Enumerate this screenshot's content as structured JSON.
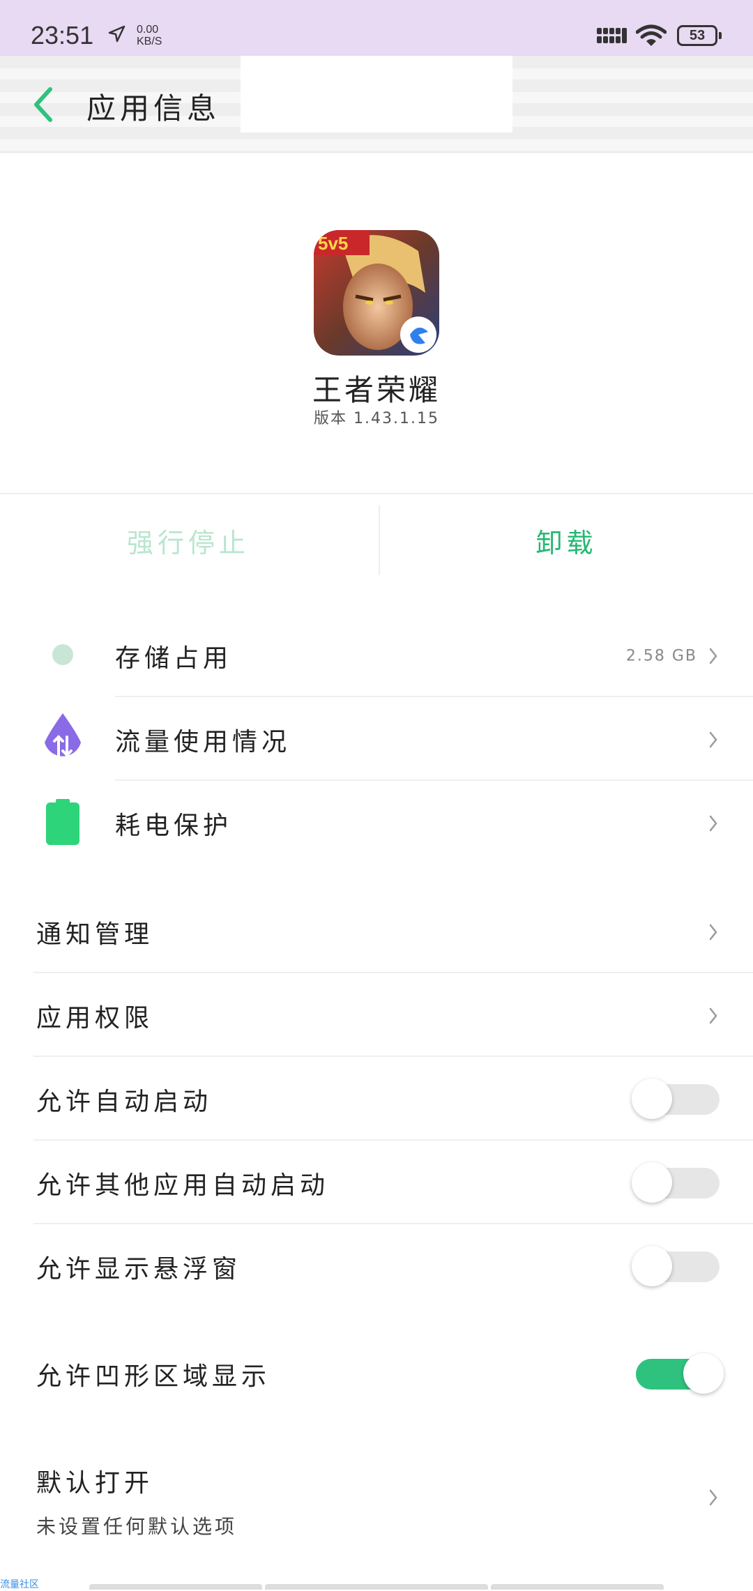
{
  "status_bar": {
    "time": "23:51",
    "speed_value": "0.00",
    "speed_unit": "KB/S",
    "battery": "53",
    "background": "#e8daf2"
  },
  "header": {
    "title": "应用信息",
    "back_icon": "chevron-left-icon"
  },
  "app": {
    "name": "王者荣耀",
    "version": "版本 1.43.1.15"
  },
  "actions": {
    "force_stop": "强行停止",
    "uninstall": "卸载",
    "accent": "#25b873",
    "disabled_color": "#b8e6cf"
  },
  "rows_group1": [
    {
      "label": "存储占用",
      "value": "2.58 GB",
      "icon": "storage-dot-icon"
    },
    {
      "label": "流量使用情况",
      "icon": "data-usage-drop-icon"
    },
    {
      "label": "耗电保护",
      "icon": "battery-icon"
    }
  ],
  "rows_group2": [
    {
      "label": "通知管理"
    },
    {
      "label": "应用权限"
    }
  ],
  "toggles": [
    {
      "label": "允许自动启动",
      "on": false
    },
    {
      "label": "允许其他应用自动启动",
      "on": false
    },
    {
      "label": "允许显示悬浮窗",
      "on": false
    }
  ],
  "notch_toggle": {
    "label": "允许凹形区域显示",
    "on": true
  },
  "default_open": {
    "label": "默认打开",
    "sublabel": "未设置任何默认选项"
  },
  "watermark": "流量社区"
}
